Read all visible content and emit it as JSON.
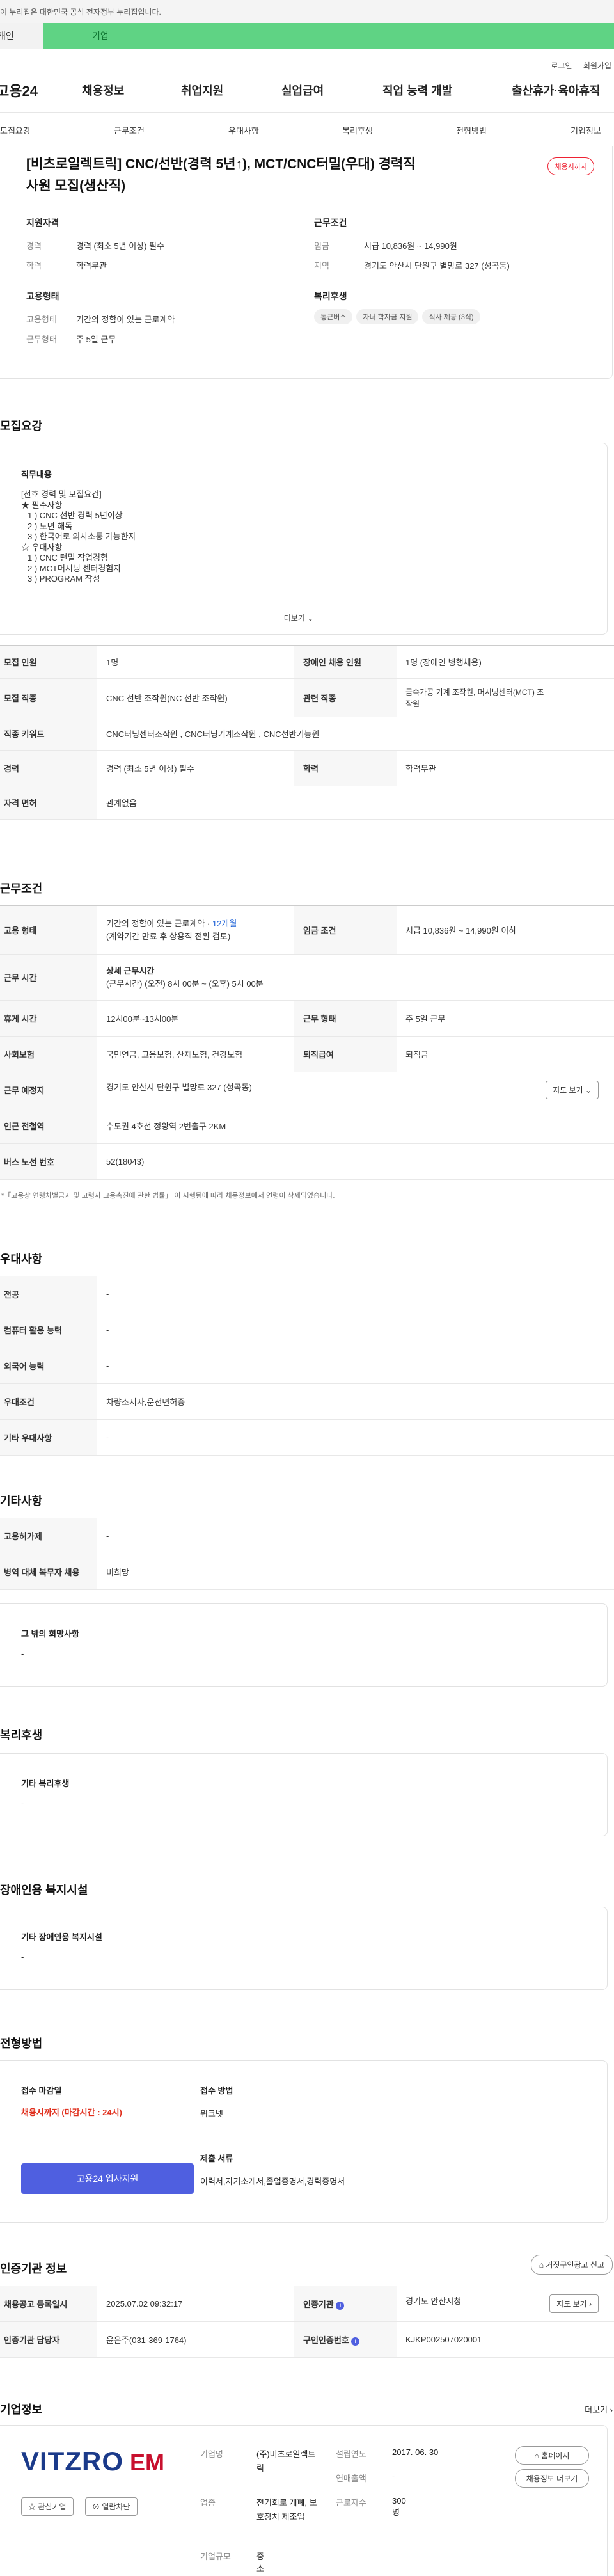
{
  "gov_banner": "이 누리집은 대한민국 공식 전자정부 누리집입니다.",
  "top_tabs": {
    "personal": "개인",
    "enterprise": "기업"
  },
  "util": {
    "login": "로그인",
    "join": "회원가입"
  },
  "site_logo": "고용24",
  "gnb": [
    "채용정보",
    "취업지원",
    "실업급여",
    "직업 능력 개발",
    "출산휴가·육아휴직"
  ],
  "subnav": [
    "모집요강",
    "근무조건",
    "우대사항",
    "복리후생",
    "전형방법",
    "기업정보"
  ],
  "job": {
    "title_line1": "[비츠로일렉트릭] CNC/선반(경력 5년↑), MCT/CNC터밀(우대) 경력직",
    "title_line2": "사원 모집(생산직)",
    "status": "채용시까지"
  },
  "qual": {
    "title": "지원자격",
    "rows": [
      {
        "k": "경력",
        "v": "경력 (최소 5년 이상) 필수"
      },
      {
        "k": "학력",
        "v": "학력무관"
      }
    ]
  },
  "work": {
    "title": "근무조건",
    "rows": [
      {
        "k": "임금",
        "v": "시급 10,836원 ~ 14,990원"
      },
      {
        "k": "지역",
        "v": "경기도 안산시 단원구 별망로 327 (성곡동)"
      }
    ]
  },
  "emp": {
    "title": "고용형태",
    "rows": [
      {
        "k": "고용형태",
        "v": "기간의 정함이 있는 근로계약"
      },
      {
        "k": "근무형태",
        "v": "주 5일 근무"
      }
    ]
  },
  "welfare_short": {
    "title": "복리후생",
    "chips": [
      "통근버스",
      "자녀 학자금 지원",
      "식사 제공 (3식)"
    ]
  },
  "recruit": {
    "title": "모집요강",
    "box_title": "직무내용",
    "lines": [
      "[선호 경력 및 모집요건]",
      "★ 필수사항",
      "1 ) CNC 선반 경력 5년이상",
      "2 ) 도면 해독",
      "3 ) 한국어로 의사소통 가능한자",
      "☆ 우대사항",
      "1 ) CNC 턴밀 작업경험",
      "2 ) MCT머시닝 센터경험자",
      "3 ) PROGRAM 작성"
    ],
    "more": "더보기"
  },
  "recruit_table": {
    "r1": {
      "h1": "모집 인원",
      "v1": "1명",
      "h2": "장애인 채용 인원",
      "v2": "1명 (장애인 병행채용)"
    },
    "r2": {
      "h1": "모집 직종",
      "v1": "CNC 선반 조작원(NC 선반 조작원)",
      "h2": "관련 직종",
      "v2a": "금속가공 기계 조작원, 머시닝센터(MCT) 조",
      "v2b": "작원"
    },
    "r3": {
      "h1": "직종 키워드",
      "v1": "CNC터닝센터조작원 , CNC터닝기계조작원 , CNC선반기능원"
    },
    "r4": {
      "h1": "경력",
      "v1": "경력 (최소 5년 이상) 필수",
      "h2": "학력",
      "v2": "학력무관"
    },
    "r5": {
      "h1": "자격 면허",
      "v1": "관계없음"
    }
  },
  "cond": {
    "title": "근무조건",
    "r1": {
      "h1": "고용 형태",
      "v1a": "기간의 정함이 있는 근로계약 · ",
      "v1b": "12개월",
      "v1c": "(계약기간 만료 후 상용직 전환 검토)",
      "h2": "임금 조건",
      "v2": "시급 10,836원 ~ 14,990원 이하"
    },
    "r2": {
      "h1": "근무 시간",
      "v1a": "상세 근무시간",
      "v1b": "(근무시간) (오전) 8시 00분 ~ (오후) 5시 00분"
    },
    "r3": {
      "h1": "휴게 시간",
      "v1": "12시00분~13시00분",
      "h2": "근무 형태",
      "v2": "주 5일 근무"
    },
    "r4": {
      "h1": "사회보험",
      "v1": "국민연금, 고용보험, 산재보험, 건강보험",
      "h2": "퇴직급여",
      "v2": "퇴직금"
    },
    "r5": {
      "h1": "근무 예정지",
      "v1": "경기도 안산시 단원구 별망로 327 (성곡동)",
      "btn": "지도 보기"
    },
    "r6": {
      "h1": "인근 전철역",
      "v1": "수도권 4호선 정왕역 2번출구 2KM"
    },
    "r7": {
      "h1": "버스 노선 번호",
      "v1": "52(18043)"
    },
    "note": "*「고용상 연령차별금지 및 고령자 고용촉진에 관한 법률」 이 시행됨에 따라 채용정보에서 연령이 삭제되었습니다."
  },
  "pref": {
    "title": "우대사항",
    "rows": [
      {
        "h": "전공",
        "v": "-"
      },
      {
        "h": "컴퓨터 활용 능력",
        "v": "-"
      },
      {
        "h": "외국어 능력",
        "v": "-"
      },
      {
        "h": "우대조건",
        "v": "차량소지자,운전면허증"
      },
      {
        "h": "기타 우대사항",
        "v": "-"
      }
    ]
  },
  "etc": {
    "title": "기타사항",
    "rows": [
      {
        "h": "고용허가제",
        "v": "-"
      },
      {
        "h": "병역 대체 복무자 채용",
        "v": "비희망"
      }
    ],
    "box_title": "그 밖의 희망사항",
    "box_v": "-"
  },
  "welfare": {
    "title": "복리후생",
    "box_title": "기타 복리후생",
    "box_v": "-"
  },
  "disab": {
    "title": "장애인용 복지시설",
    "box_title": "기타 장애인용 복지시설",
    "box_v": "-"
  },
  "process": {
    "title": "전형방법",
    "deadline_h": "접수 마감일",
    "deadline_v": "채용시까지 (마감시간 : 24시)",
    "apply_btn": "고용24 입사지원",
    "method_h": "접수 방법",
    "method_v": "워크넷",
    "docs_h": "제출 서류",
    "docs_v": "이력서,자기소개서,졸업증명서,경력증명서"
  },
  "cert": {
    "title": "인증기관 정보",
    "report_btn": "거짓구인광고 신고",
    "r1": {
      "h1": "채용공고 등록일시",
      "v1": "2025.07.02 09:32:17",
      "h2": "인증기관",
      "v2": "경기도 안산시청",
      "btn": "지도 보기"
    },
    "r2": {
      "h1": "인증기관 담당자",
      "v1": "윤은주(031-369-1764)",
      "h2": "구인인증번호",
      "v2": "KJKP002507020001"
    }
  },
  "company": {
    "title": "기업정보",
    "more": "더보기",
    "logo_main": "VITZRO",
    "logo_sub": "EM",
    "fav_btn": "관심기업",
    "block_btn": "열람차단",
    "rows": [
      {
        "k": "기업명",
        "v": "(주)비츠로일렉트릭",
        "k2": "설립연도",
        "v2": "2017. 06. 30"
      },
      {
        "k": "",
        "v": "",
        "k2": "연매출액",
        "v2": "-"
      },
      {
        "k": "업종",
        "v": "전기회로 개폐, 보호장치 제조업",
        "k2": "근로자수",
        "v2": "300명"
      },
      {
        "k": "기업규모",
        "v": "중소기업",
        "k2": "",
        "v2": ""
      }
    ],
    "home_btn": "홈페이지",
    "jobs_btn": "채용정보 더보기"
  }
}
